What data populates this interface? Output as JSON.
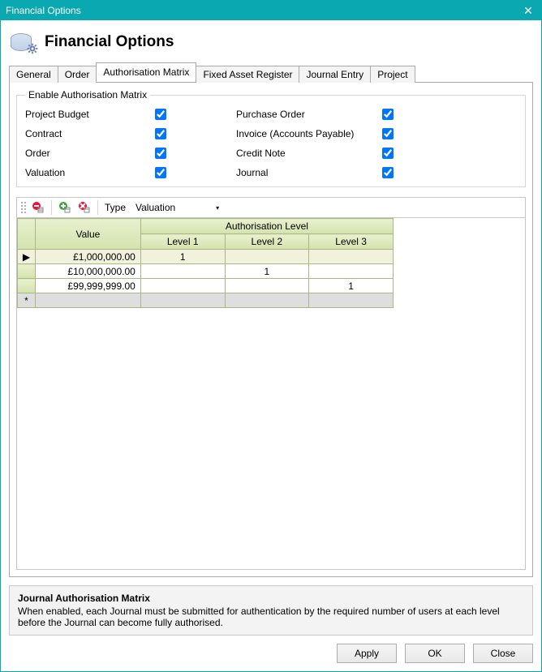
{
  "window": {
    "title": "Financial Options"
  },
  "header": {
    "title": "Financial Options"
  },
  "tabs": {
    "items": [
      {
        "label": "General"
      },
      {
        "label": "Order"
      },
      {
        "label": "Authorisation Matrix"
      },
      {
        "label": "Fixed Asset Register"
      },
      {
        "label": "Journal Entry"
      },
      {
        "label": "Project"
      }
    ],
    "active_index": 2
  },
  "enable_matrix": {
    "legend": "Enable Authorisation Matrix",
    "left": [
      {
        "label": "Project Budget",
        "checked": true
      },
      {
        "label": "Contract",
        "checked": true
      },
      {
        "label": "Order",
        "checked": true
      },
      {
        "label": "Valuation",
        "checked": true
      }
    ],
    "right": [
      {
        "label": "Purchase Order",
        "checked": true
      },
      {
        "label": "Invoice (Accounts Payable)",
        "checked": true
      },
      {
        "label": "Credit Note",
        "checked": true
      },
      {
        "label": "Journal",
        "checked": true
      }
    ]
  },
  "toolbar": {
    "type_label": "Type",
    "type_value": "Valuation"
  },
  "grid": {
    "group_header": "Authorisation Level",
    "columns": {
      "value": "Value",
      "l1": "Level 1",
      "l2": "Level 2",
      "l3": "Level 3"
    },
    "rows": [
      {
        "marker": "▶",
        "value": "£1,000,000.00",
        "l1": "1",
        "l2": "",
        "l3": "",
        "selected": true
      },
      {
        "marker": "",
        "value": "£10,000,000.00",
        "l1": "",
        "l2": "1",
        "l3": ""
      },
      {
        "marker": "",
        "value": "£99,999,999.00",
        "l1": "",
        "l2": "",
        "l3": "1"
      }
    ],
    "new_marker": "*"
  },
  "info": {
    "title": "Journal Authorisation Matrix",
    "body": "When enabled, each Journal must be submitted for authentication by the required number of users at each level before the Journal can become fully authorised."
  },
  "buttons": {
    "apply": "Apply",
    "ok": "OK",
    "close": "Close"
  }
}
